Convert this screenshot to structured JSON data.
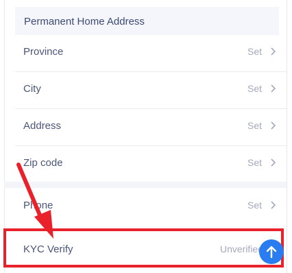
{
  "section": {
    "title": "Permanent Home Address"
  },
  "rows": [
    {
      "label": "Province",
      "value": "Set"
    },
    {
      "label": "City",
      "value": "Set"
    },
    {
      "label": "Address",
      "value": "Set"
    },
    {
      "label": "Zip code",
      "value": "Set"
    },
    {
      "label": "Phone",
      "value": "Set"
    }
  ],
  "kyc": {
    "label": "KYC Verify",
    "value": "Unverified"
  },
  "icons": {
    "chevron": "chevron-right-icon",
    "scroll_top": "arrow-up-icon",
    "annotation": "annotation-arrow"
  },
  "colors": {
    "highlight": "#e8212b",
    "fab": "#2a7df0",
    "label": "#4b5578",
    "value": "#a3a9bc",
    "header_bg": "#f4f6fb"
  }
}
